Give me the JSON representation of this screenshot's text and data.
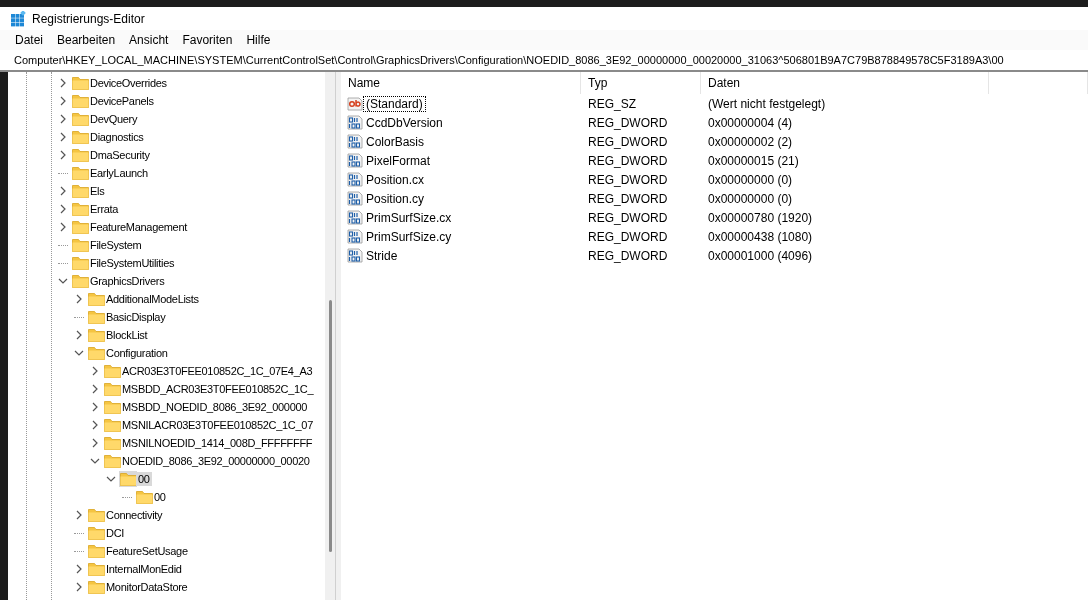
{
  "window": {
    "title": "Registrierungs-Editor"
  },
  "menu": [
    "Datei",
    "Bearbeiten",
    "Ansicht",
    "Favoriten",
    "Hilfe"
  ],
  "address": "Computer\\HKEY_LOCAL_MACHINE\\SYSTEM\\CurrentControlSet\\Control\\GraphicsDrivers\\Configuration\\NOEDID_8086_3E92_00000000_00020000_31063^506801B9A7C79B878849578C5F3189A3\\00",
  "tree": [
    {
      "name": "DeviceOverrides",
      "expanded": false,
      "selected": false
    },
    {
      "name": "DevicePanels",
      "expanded": false,
      "selected": false
    },
    {
      "name": "DevQuery",
      "expanded": false,
      "selected": false
    },
    {
      "name": "Diagnostics",
      "expanded": false,
      "selected": false
    },
    {
      "name": "DmaSecurity",
      "expanded": false,
      "selected": false
    },
    {
      "name": "EarlyLaunch",
      "selected": false
    },
    {
      "name": "Els",
      "expanded": false,
      "selected": false
    },
    {
      "name": "Errata",
      "expanded": false,
      "selected": false
    },
    {
      "name": "FeatureManagement",
      "expanded": false,
      "selected": false
    },
    {
      "name": "FileSystem",
      "selected": false
    },
    {
      "name": "FileSystemUtilities",
      "selected": false
    },
    {
      "name": "GraphicsDrivers",
      "expanded": true,
      "selected": false,
      "children": [
        {
          "name": "AdditionalModeLists",
          "expanded": false,
          "selected": false
        },
        {
          "name": "BasicDisplay",
          "selected": false
        },
        {
          "name": "BlockList",
          "expanded": false,
          "selected": false
        },
        {
          "name": "Configuration",
          "expanded": true,
          "selected": false,
          "children": [
            {
              "name": "ACR03E3T0FEE010852C_1C_07E4_A3",
              "expanded": false,
              "selected": false
            },
            {
              "name": "MSBDD_ACR03E3T0FEE010852C_1C_",
              "expanded": false,
              "selected": false
            },
            {
              "name": "MSBDD_NOEDID_8086_3E92_000000",
              "expanded": false,
              "selected": false
            },
            {
              "name": "MSNILACR03E3T0FEE010852C_1C_07",
              "expanded": false,
              "selected": false
            },
            {
              "name": "MSNILNOEDID_1414_008D_FFFFFFFF",
              "expanded": false,
              "selected": false
            },
            {
              "name": "NOEDID_8086_3E92_00000000_00020",
              "expanded": true,
              "selected": false,
              "children": [
                {
                  "name": "00",
                  "expanded": true,
                  "selected": true,
                  "children": [
                    {
                      "name": "00",
                      "selected": false
                    }
                  ]
                }
              ]
            }
          ]
        },
        {
          "name": "Connectivity",
          "expanded": false,
          "selected": false
        },
        {
          "name": "DCI",
          "selected": false
        },
        {
          "name": "FeatureSetUsage",
          "selected": false
        },
        {
          "name": "InternalMonEdid",
          "expanded": false,
          "selected": false
        },
        {
          "name": "MonitorDataStore",
          "expanded": false,
          "selected": false
        }
      ]
    }
  ],
  "columns": [
    "Name",
    "Typ",
    "Daten"
  ],
  "values": [
    {
      "kind": "string",
      "name": "(Standard)",
      "type": "REG_SZ",
      "data": "(Wert nicht festgelegt)",
      "focused": true
    },
    {
      "kind": "dword",
      "name": "CcdDbVersion",
      "type": "REG_DWORD",
      "data": "0x00000004 (4)",
      "focused": false
    },
    {
      "kind": "dword",
      "name": "ColorBasis",
      "type": "REG_DWORD",
      "data": "0x00000002 (2)",
      "focused": false
    },
    {
      "kind": "dword",
      "name": "PixelFormat",
      "type": "REG_DWORD",
      "data": "0x00000015 (21)",
      "focused": false
    },
    {
      "kind": "dword",
      "name": "Position.cx",
      "type": "REG_DWORD",
      "data": "0x00000000 (0)",
      "focused": false
    },
    {
      "kind": "dword",
      "name": "Position.cy",
      "type": "REG_DWORD",
      "data": "0x00000000 (0)",
      "focused": false
    },
    {
      "kind": "dword",
      "name": "PrimSurfSize.cx",
      "type": "REG_DWORD",
      "data": "0x00000780 (1920)",
      "focused": false
    },
    {
      "kind": "dword",
      "name": "PrimSurfSize.cy",
      "type": "REG_DWORD",
      "data": "0x00000438 (1080)",
      "focused": false
    },
    {
      "kind": "dword",
      "name": "Stride",
      "type": "REG_DWORD",
      "data": "0x00001000 (4096)",
      "focused": false
    }
  ]
}
